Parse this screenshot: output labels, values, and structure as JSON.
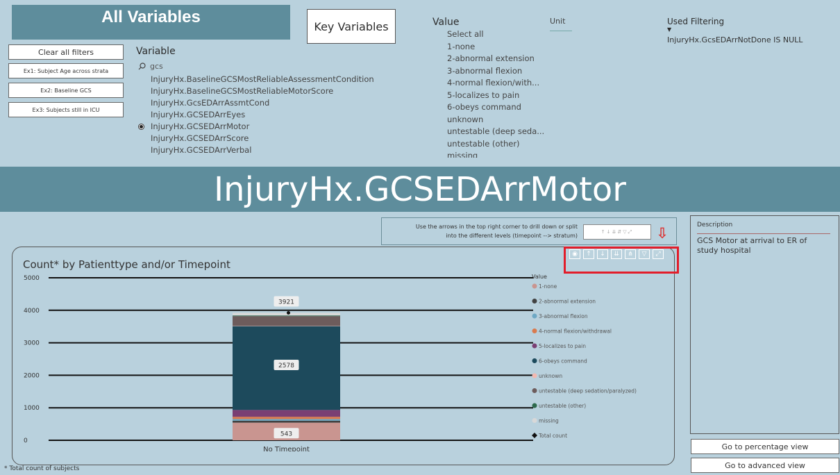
{
  "header": {
    "all_variables": "All Variables",
    "key_variables": "Key Variables"
  },
  "buttons": {
    "clear": "Clear all filters",
    "ex1": "Ex1: Subject Age across strata",
    "ex2": "Ex2: Baseline GCS",
    "ex3": "Ex3: Subjects still in ICU"
  },
  "variable": {
    "heading": "Variable",
    "search": "gcs",
    "items": [
      "InjuryHx.BaselineGCSMostReliableAssessmentCondition",
      "InjuryHx.BaselineGCSMostReliableMotorScore",
      "InjuryHx.GcsEDArrAssmtCond",
      "InjuryHx.GCSEDArrEyes",
      "InjuryHx.GCSEDArrMotor",
      "InjuryHx.GCSEDArrScore",
      "InjuryHx.GCSEDArrVerbal"
    ],
    "selected": "InjuryHx.GCSEDArrMotor"
  },
  "value_filter": {
    "heading": "Value",
    "items": [
      "Select all",
      "1-none",
      "2-abnormal extension",
      "3-abnormal flexion",
      "4-normal flexion/with...",
      "5-localizes to pain",
      "6-obeys command",
      "unknown",
      "untestable (deep seda...",
      "untestable (other)",
      "missing"
    ]
  },
  "unit": {
    "heading": "Unit"
  },
  "used_filtering": {
    "heading": "Used Filtering",
    "value": "InjuryHx.GcsEDArrNotDone IS NULL"
  },
  "banner": {
    "title": "InjuryHx.GCSEDArrMotor"
  },
  "hint": {
    "line1": "Use the arrows in the top right corner to drill down or split",
    "line2": "into the different levels (timepoint --> stratum)"
  },
  "description": {
    "label": "Description",
    "text": "GCS Motor at arrival to ER of study hospital"
  },
  "nav": {
    "percentage": "Go to percentage view",
    "advanced": "Go to advanced view"
  },
  "footnote": "* Total count of subjects",
  "toolbar_icons": [
    "focus-icon",
    "drill-up-icon",
    "drill-down-icon",
    "expand-all-icon",
    "drill-hierarchy-icon",
    "filter-icon",
    "focus-mode-icon"
  ],
  "colors": {
    "panel_bg": "#b9d1dd",
    "banner": "#5e8d9c",
    "highlight": "#e21d2a"
  },
  "chart_data": {
    "type": "bar",
    "title": "Count* by Patienttype and/or Timepoint",
    "categories": [
      "No Timepoint"
    ],
    "ylim": [
      0,
      5000
    ],
    "yticks": [
      0,
      1000,
      2000,
      3000,
      4000,
      5000
    ],
    "legend_title": "Value",
    "legend_position": "right",
    "total": 3921,
    "series": [
      {
        "name": "1-none",
        "values": [
          543
        ],
        "color": "#c99590"
      },
      {
        "name": "2-abnormal extension",
        "values": [
          60
        ],
        "color": "#424242"
      },
      {
        "name": "3-abnormal flexion",
        "values": [
          50
        ],
        "color": "#6ea8c4"
      },
      {
        "name": "4-normal flexion/withdrawal",
        "values": [
          70
        ],
        "color": "#d97b4f"
      },
      {
        "name": "5-localizes to pain",
        "values": [
          210
        ],
        "color": "#7a3f73"
      },
      {
        "name": "6-obeys command",
        "values": [
          2578
        ],
        "color": "#1d4a5c"
      },
      {
        "name": "unknown",
        "values": [
          10
        ],
        "color": "#f2b8b0"
      },
      {
        "name": "untestable (deep sedation/paralyzed)",
        "values": [
          300
        ],
        "color": "#6d5c5c"
      },
      {
        "name": "untestable (other)",
        "values": [
          20
        ],
        "color": "#2e6a4d"
      },
      {
        "name": "missing",
        "values": [
          80
        ],
        "color": "#d8d8d8"
      }
    ],
    "total_series_name": "Total count",
    "data_labels": [
      {
        "series": "1-none",
        "value": "543"
      },
      {
        "series": "6-obeys command",
        "value": "2578"
      },
      {
        "series": "Total count",
        "value": "3921"
      }
    ]
  }
}
